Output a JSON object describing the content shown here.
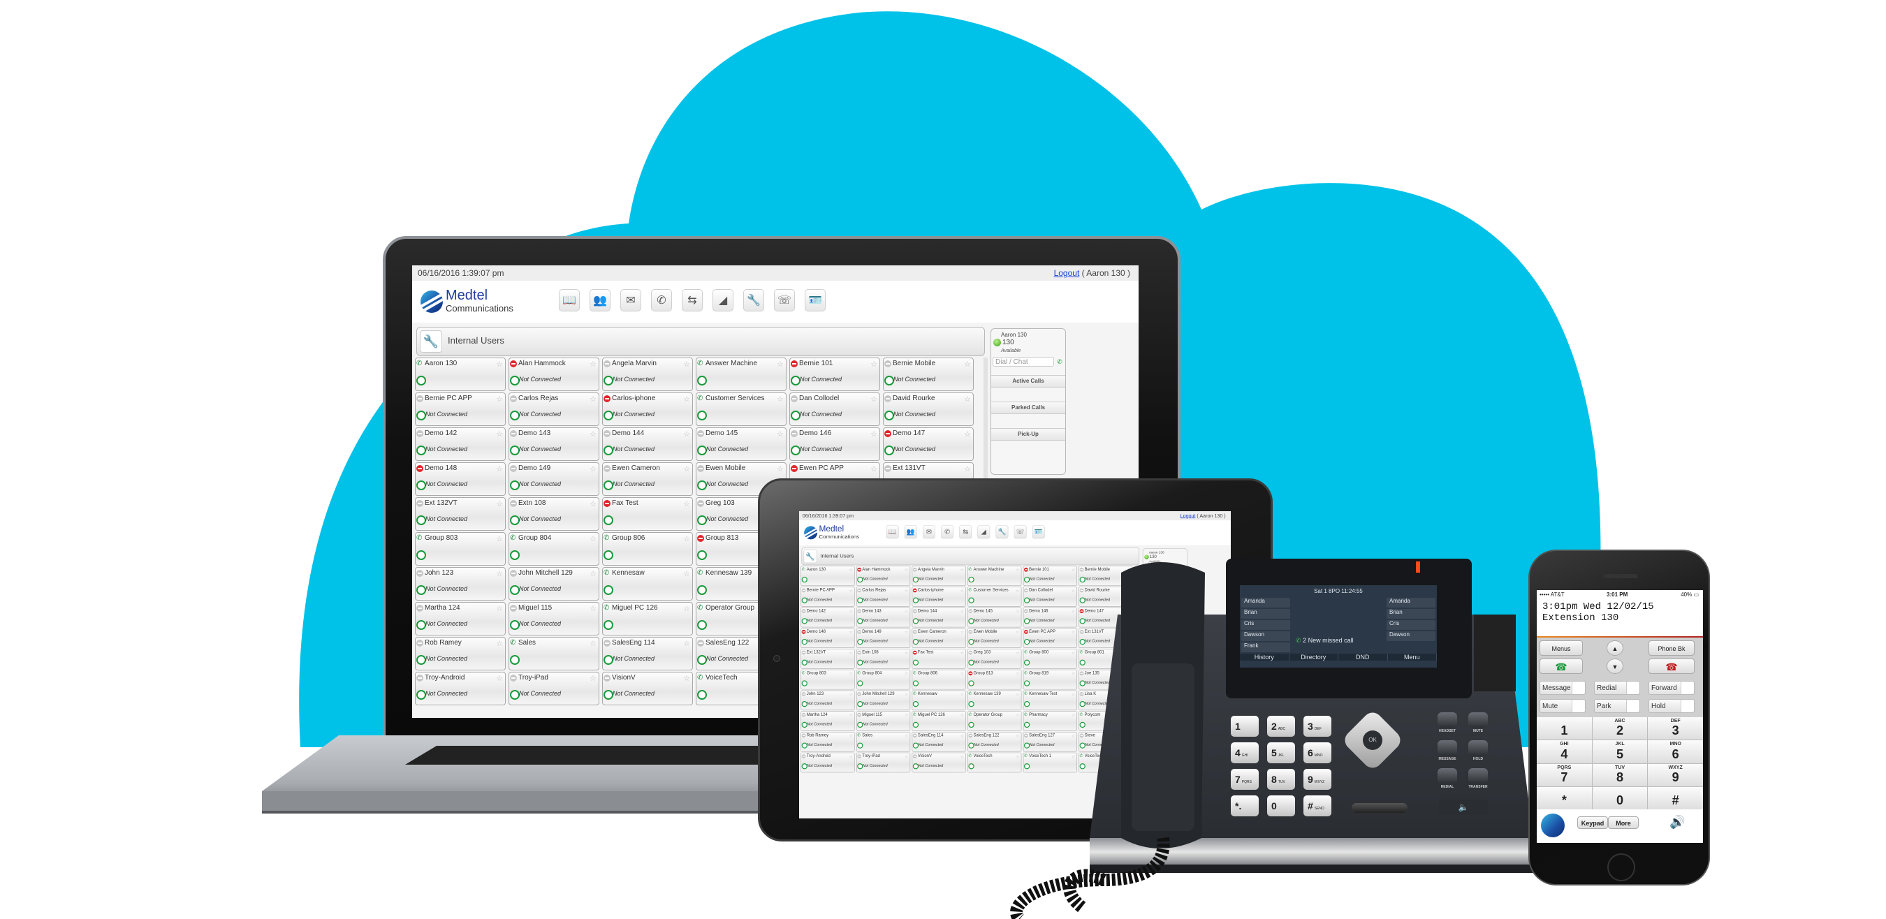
{
  "scene": {
    "description": "Medtel Communications unified communications product shot",
    "colors": {
      "cloud": "#00c2e8",
      "background": "#ffffff",
      "accent_green": "#1a9a3b",
      "status_red": "#e2252b",
      "brand_blue": "#1f3e9c"
    }
  },
  "app": {
    "datetime": "06/16/2016  1:39:07 pm",
    "logout_link": "Logout",
    "logout_user": "( Aaron 130 )",
    "brand_line1": "Medtel",
    "brand_line2": "Communications",
    "toolbar_icons": [
      "directory-icon",
      "conference-icon",
      "voicemail-icon",
      "call-forward-icon",
      "call-transfer-icon",
      "reports-icon",
      "settings-icon",
      "phone-system-icon",
      "contact-card-icon"
    ],
    "panel_title": "Internal Users",
    "not_connected_label": "Not Connected",
    "users": [
      {
        "name": "Aaron 130",
        "status": "phone",
        "connected": true
      },
      {
        "name": "Alan Hammock",
        "status": "red",
        "connected": false
      },
      {
        "name": "Angela Marvin",
        "status": "gray",
        "connected": false
      },
      {
        "name": "Answer Machine",
        "status": "phone",
        "connected": true
      },
      {
        "name": "Bernie 101",
        "status": "red",
        "connected": false
      },
      {
        "name": "Bernie Mobile",
        "status": "gray",
        "connected": false
      },
      {
        "name": "Bernie PC APP",
        "status": "gray",
        "connected": false
      },
      {
        "name": "Carlos Rejas",
        "status": "gray",
        "connected": false
      },
      {
        "name": "Carlos-iphone",
        "status": "red",
        "connected": false
      },
      {
        "name": "Customer Services",
        "status": "phone",
        "connected": true
      },
      {
        "name": "Dan Collodel",
        "status": "gray",
        "connected": false
      },
      {
        "name": "David Rourke",
        "status": "gray",
        "connected": false
      },
      {
        "name": "Demo 142",
        "status": "gray",
        "connected": false
      },
      {
        "name": "Demo 143",
        "status": "gray",
        "connected": false
      },
      {
        "name": "Demo 144",
        "status": "gray",
        "connected": false
      },
      {
        "name": "Demo 145",
        "status": "gray",
        "connected": false
      },
      {
        "name": "Demo 146",
        "status": "gray",
        "connected": false
      },
      {
        "name": "Demo 147",
        "status": "red",
        "connected": false
      },
      {
        "name": "Demo 148",
        "status": "red",
        "connected": false
      },
      {
        "name": "Demo 149",
        "status": "gray",
        "connected": false
      },
      {
        "name": "Ewen Cameron",
        "status": "gray",
        "connected": false
      },
      {
        "name": "Ewen Mobile",
        "status": "gray",
        "connected": false
      },
      {
        "name": "Ewen PC APP",
        "status": "red",
        "connected": false
      },
      {
        "name": "Ext 131VT",
        "status": "gray",
        "connected": false
      },
      {
        "name": "Ext 132VT",
        "status": "gray",
        "connected": false
      },
      {
        "name": "Extn 108",
        "status": "gray",
        "connected": false
      },
      {
        "name": "Fax Test",
        "status": "red",
        "connected": true
      },
      {
        "name": "Greg 103",
        "status": "gray",
        "connected": false
      },
      {
        "name": "Group 800",
        "status": "phone",
        "connected": true
      },
      {
        "name": "Group 801",
        "status": "phone",
        "connected": true
      },
      {
        "name": "Group 803",
        "status": "phone",
        "connected": true
      },
      {
        "name": "Group 804",
        "status": "phone",
        "connected": true
      },
      {
        "name": "Group 806",
        "status": "phone",
        "connected": true
      },
      {
        "name": "Group 813",
        "status": "red",
        "connected": true
      },
      {
        "name": "Group 819",
        "status": "phone",
        "connected": true
      },
      {
        "name": "Joe 135",
        "status": "gray",
        "connected": false
      },
      {
        "name": "John 123",
        "status": "gray",
        "connected": false
      },
      {
        "name": "John Mitchell 129",
        "status": "gray",
        "connected": false
      },
      {
        "name": "Kennesaw",
        "status": "phone",
        "connected": true
      },
      {
        "name": "Kennesaw 139",
        "status": "phone",
        "connected": true
      },
      {
        "name": "Kennesaw Test",
        "status": "phone",
        "connected": true
      },
      {
        "name": "Lisa K",
        "status": "gray",
        "connected": false
      },
      {
        "name": "Martha 124",
        "status": "gray",
        "connected": false
      },
      {
        "name": "Miguel 115",
        "status": "gray",
        "connected": false
      },
      {
        "name": "Miguel PC 126",
        "status": "phone",
        "connected": true
      },
      {
        "name": "Operator Group",
        "status": "phone",
        "connected": true
      },
      {
        "name": "Pharmacy",
        "status": "phone",
        "connected": true
      },
      {
        "name": "Polycom",
        "status": "phone",
        "connected": true
      },
      {
        "name": "Rob Ramey",
        "status": "gray",
        "connected": false
      },
      {
        "name": "Sales",
        "status": "phone",
        "connected": true
      },
      {
        "name": "SalesEng 114",
        "status": "gray",
        "connected": false
      },
      {
        "name": "SalesEng 122",
        "status": "gray",
        "connected": false
      },
      {
        "name": "SalesEng 127",
        "status": "gray",
        "connected": false
      },
      {
        "name": "Steve",
        "status": "gray",
        "connected": false
      },
      {
        "name": "Troy-Android",
        "status": "gray",
        "connected": false
      },
      {
        "name": "Troy-iPad",
        "status": "gray",
        "connected": false
      },
      {
        "name": "VisionV",
        "status": "gray",
        "connected": false
      },
      {
        "name": "VoiceTech",
        "status": "phone",
        "connected": true
      },
      {
        "name": "VoiceTech 1",
        "status": "phone",
        "connected": true
      },
      {
        "name": "VoiceTech 2",
        "status": "phone",
        "connected": true
      }
    ],
    "laptop_users": [
      {
        "name": "Aaron 130",
        "status": "phone",
        "connected": true
      },
      {
        "name": "Alan Hammock",
        "status": "red",
        "connected": false
      },
      {
        "name": "Angela Marvin",
        "status": "gray",
        "connected": false
      },
      {
        "name": "Answer Machine",
        "status": "phone",
        "connected": true
      },
      {
        "name": "Bernie 101",
        "status": "red",
        "connected": false
      },
      {
        "name": "Bernie Mobile",
        "status": "gray",
        "connected": false
      },
      {
        "name": "Bernie PC APP",
        "status": "gray",
        "connected": false
      },
      {
        "name": "Carlos Rejas",
        "status": "gray",
        "connected": false
      },
      {
        "name": "Carlos-iphone",
        "status": "red",
        "connected": false
      },
      {
        "name": "Customer Services",
        "status": "phone",
        "connected": true
      },
      {
        "name": "Dan Collodel",
        "status": "gray",
        "connected": false
      },
      {
        "name": "David Rourke",
        "status": "gray",
        "connected": false
      },
      {
        "name": "Demo 142",
        "status": "gray",
        "connected": false
      },
      {
        "name": "Demo 143",
        "status": "gray",
        "connected": false
      },
      {
        "name": "Demo 144",
        "status": "gray",
        "connected": false
      },
      {
        "name": "Demo 145",
        "status": "gray",
        "connected": false
      },
      {
        "name": "Demo 146",
        "status": "gray",
        "connected": false
      },
      {
        "name": "Demo 147",
        "status": "red",
        "connected": false
      },
      {
        "name": "Demo 148",
        "status": "red",
        "connected": false
      },
      {
        "name": "Demo 149",
        "status": "gray",
        "connected": false
      },
      {
        "name": "Ewen Cameron",
        "status": "gray",
        "connected": false
      },
      {
        "name": "Ewen Mobile",
        "status": "gray",
        "connected": false
      },
      {
        "name": "Ewen PC APP",
        "status": "red",
        "connected": false
      },
      {
        "name": "Ext 131VT",
        "status": "gray",
        "connected": false
      },
      {
        "name": "Ext 132VT",
        "status": "gray",
        "connected": false
      },
      {
        "name": "Extn 108",
        "status": "gray",
        "connected": false
      },
      {
        "name": "Fax Test",
        "status": "red",
        "connected": true
      },
      {
        "name": "Greg 103",
        "status": "gray",
        "connected": false
      },
      {
        "name": "",
        "status": "none",
        "connected": true
      },
      {
        "name": "",
        "status": "none",
        "connected": true
      },
      {
        "name": "Group 803",
        "status": "phone",
        "connected": true
      },
      {
        "name": "Group 804",
        "status": "phone",
        "connected": true
      },
      {
        "name": "Group 806",
        "status": "phone",
        "connected": true
      },
      {
        "name": "Group 813",
        "status": "red",
        "connected": true
      },
      {
        "name": "",
        "status": "none",
        "connected": true
      },
      {
        "name": "",
        "status": "none",
        "connected": true
      },
      {
        "name": "John 123",
        "status": "gray",
        "connected": false
      },
      {
        "name": "John Mitchell 129",
        "status": "gray",
        "connected": false
      },
      {
        "name": "Kennesaw",
        "status": "phone",
        "connected": true
      },
      {
        "name": "Kennesaw 139",
        "status": "phone",
        "connected": true
      },
      {
        "name": "",
        "status": "none",
        "connected": true
      },
      {
        "name": "",
        "status": "none",
        "connected": true
      },
      {
        "name": "Martha 124",
        "status": "gray",
        "connected": false
      },
      {
        "name": "Miguel 115",
        "status": "gray",
        "connected": false
      },
      {
        "name": "Miguel PC 126",
        "status": "phone",
        "connected": true
      },
      {
        "name": "Operator Group",
        "status": "phone",
        "connected": true
      },
      {
        "name": "",
        "status": "none",
        "connected": true
      },
      {
        "name": "",
        "status": "none",
        "connected": true
      },
      {
        "name": "Rob Ramey",
        "status": "gray",
        "connected": false
      },
      {
        "name": "Sales",
        "status": "phone",
        "connected": true
      },
      {
        "name": "SalesEng 114",
        "status": "gray",
        "connected": false
      },
      {
        "name": "SalesEng 122",
        "status": "gray",
        "connected": false
      },
      {
        "name": "",
        "status": "none",
        "connected": true
      },
      {
        "name": "",
        "status": "none",
        "connected": true
      },
      {
        "name": "Troy-Android",
        "status": "gray",
        "connected": false
      },
      {
        "name": "Troy-iPad",
        "status": "gray",
        "connected": false
      },
      {
        "name": "VisionV",
        "status": "gray",
        "connected": false
      },
      {
        "name": "VoiceTech",
        "status": "phone",
        "connected": true
      }
    ],
    "side_panel": {
      "user_name": "Aaron 130",
      "extension": "130",
      "presence": "Available",
      "dial_placeholder": "Dial / Chat",
      "buttons": [
        "Active Calls",
        "Parked Calls",
        "Pick-Up"
      ]
    }
  },
  "desk_phone": {
    "screen_header": "Sat 1 8PO  11:24:55",
    "line_keys_left": [
      "Amanda",
      "Brian",
      "Cris",
      "Dawson",
      "Frank"
    ],
    "line_keys_right": [
      "Amanda",
      "Brian",
      "Cris",
      "Dawson"
    ],
    "notification": "2 New missed call",
    "softkeys": [
      "History",
      "Directory",
      "DND",
      "Menu"
    ],
    "keypad": [
      {
        "digit": "1",
        "letters": ""
      },
      {
        "digit": "2",
        "letters": "ABC"
      },
      {
        "digit": "3",
        "letters": "DEF"
      },
      {
        "digit": "4",
        "letters": "GHI"
      },
      {
        "digit": "5",
        "letters": "JKL"
      },
      {
        "digit": "6",
        "letters": "MNO"
      },
      {
        "digit": "7",
        "letters": "PQRS"
      },
      {
        "digit": "8",
        "letters": "TUV"
      },
      {
        "digit": "9",
        "letters": "WXYZ"
      },
      {
        "digit": "*.",
        "letters": ""
      },
      {
        "digit": "0",
        "letters": ""
      },
      {
        "digit": "#",
        "letters": "SEND"
      }
    ],
    "nav_center": "OK",
    "function_keys": [
      "HEADSET",
      "MUTE",
      "MESSAGE",
      "HOLD",
      "REDIAL",
      "TRANSFER"
    ]
  },
  "mobile": {
    "status_left": "••••• AT&T",
    "status_time": "3:01 PM",
    "status_battery": "40%",
    "lcd_line1": "3:01pm Wed  12/02/15",
    "lcd_line2": "Extension 130",
    "menus_label": "Menus",
    "phonebook_label": "Phone Bk",
    "soft_buttons": [
      "Message",
      "Redial",
      "Forward",
      "Mute",
      "Park",
      "Hold"
    ],
    "keypad": [
      {
        "digit": "1",
        "letters": ""
      },
      {
        "digit": "2",
        "letters": "ABC"
      },
      {
        "digit": "3",
        "letters": "DEF"
      },
      {
        "digit": "4",
        "letters": "GHI"
      },
      {
        "digit": "5",
        "letters": "JKL"
      },
      {
        "digit": "6",
        "letters": "MNO"
      },
      {
        "digit": "7",
        "letters": "PQRS"
      },
      {
        "digit": "8",
        "letters": "TUV"
      },
      {
        "digit": "9",
        "letters": "WXYZ"
      },
      {
        "digit": "*",
        "letters": ""
      },
      {
        "digit": "0",
        "letters": ""
      },
      {
        "digit": "#",
        "letters": ""
      }
    ],
    "tab_keypad": "Keypad",
    "tab_more": "More"
  }
}
